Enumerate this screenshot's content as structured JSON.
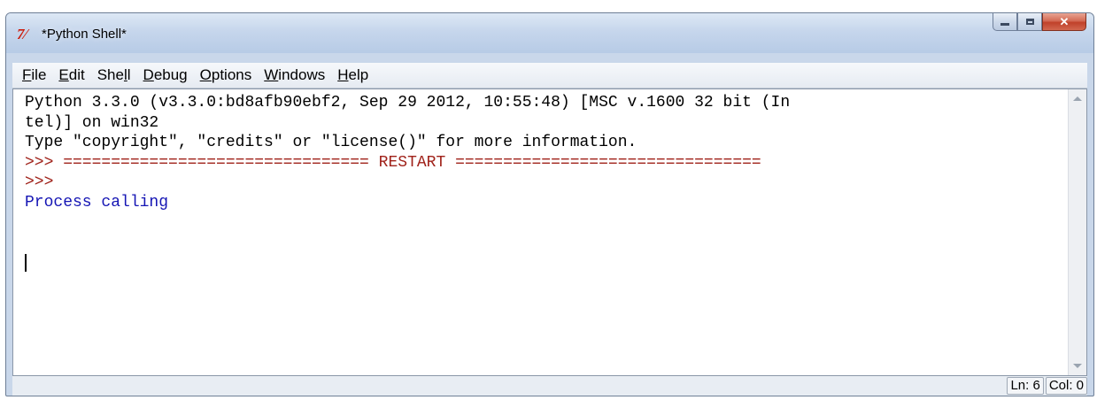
{
  "window": {
    "title": "*Python Shell*",
    "icon": "idle-icon",
    "icon_glyph": "7⁄"
  },
  "menu": {
    "file": {
      "hot": "F",
      "rest": "ile"
    },
    "edit": {
      "hot": "E",
      "rest": "dit"
    },
    "shell": {
      "pre": "She",
      "hot": "l",
      "rest": "l"
    },
    "debug": {
      "hot": "D",
      "rest": "ebug"
    },
    "options": {
      "hot": "O",
      "rest": "ptions"
    },
    "windows": {
      "hot": "W",
      "rest": "indows"
    },
    "help": {
      "hot": "H",
      "rest": "elp"
    }
  },
  "shell": {
    "banner1": "Python 3.3.0 (v3.3.0:bd8afb90ebf2, Sep 29 2012, 10:55:48) [MSC v.1600 32 bit (In",
    "banner2": "tel)] on win32",
    "banner3": "Type \"copyright\", \"credits\" or \"license()\" for more information.",
    "restart": ">>> ================================ RESTART ================================",
    "prompt": ">>>",
    "output": "Process calling"
  },
  "status": {
    "line": "Ln: 6",
    "col": "Col: 0"
  },
  "colors": {
    "prompt": "#a0221a",
    "output": "#1515b4"
  }
}
